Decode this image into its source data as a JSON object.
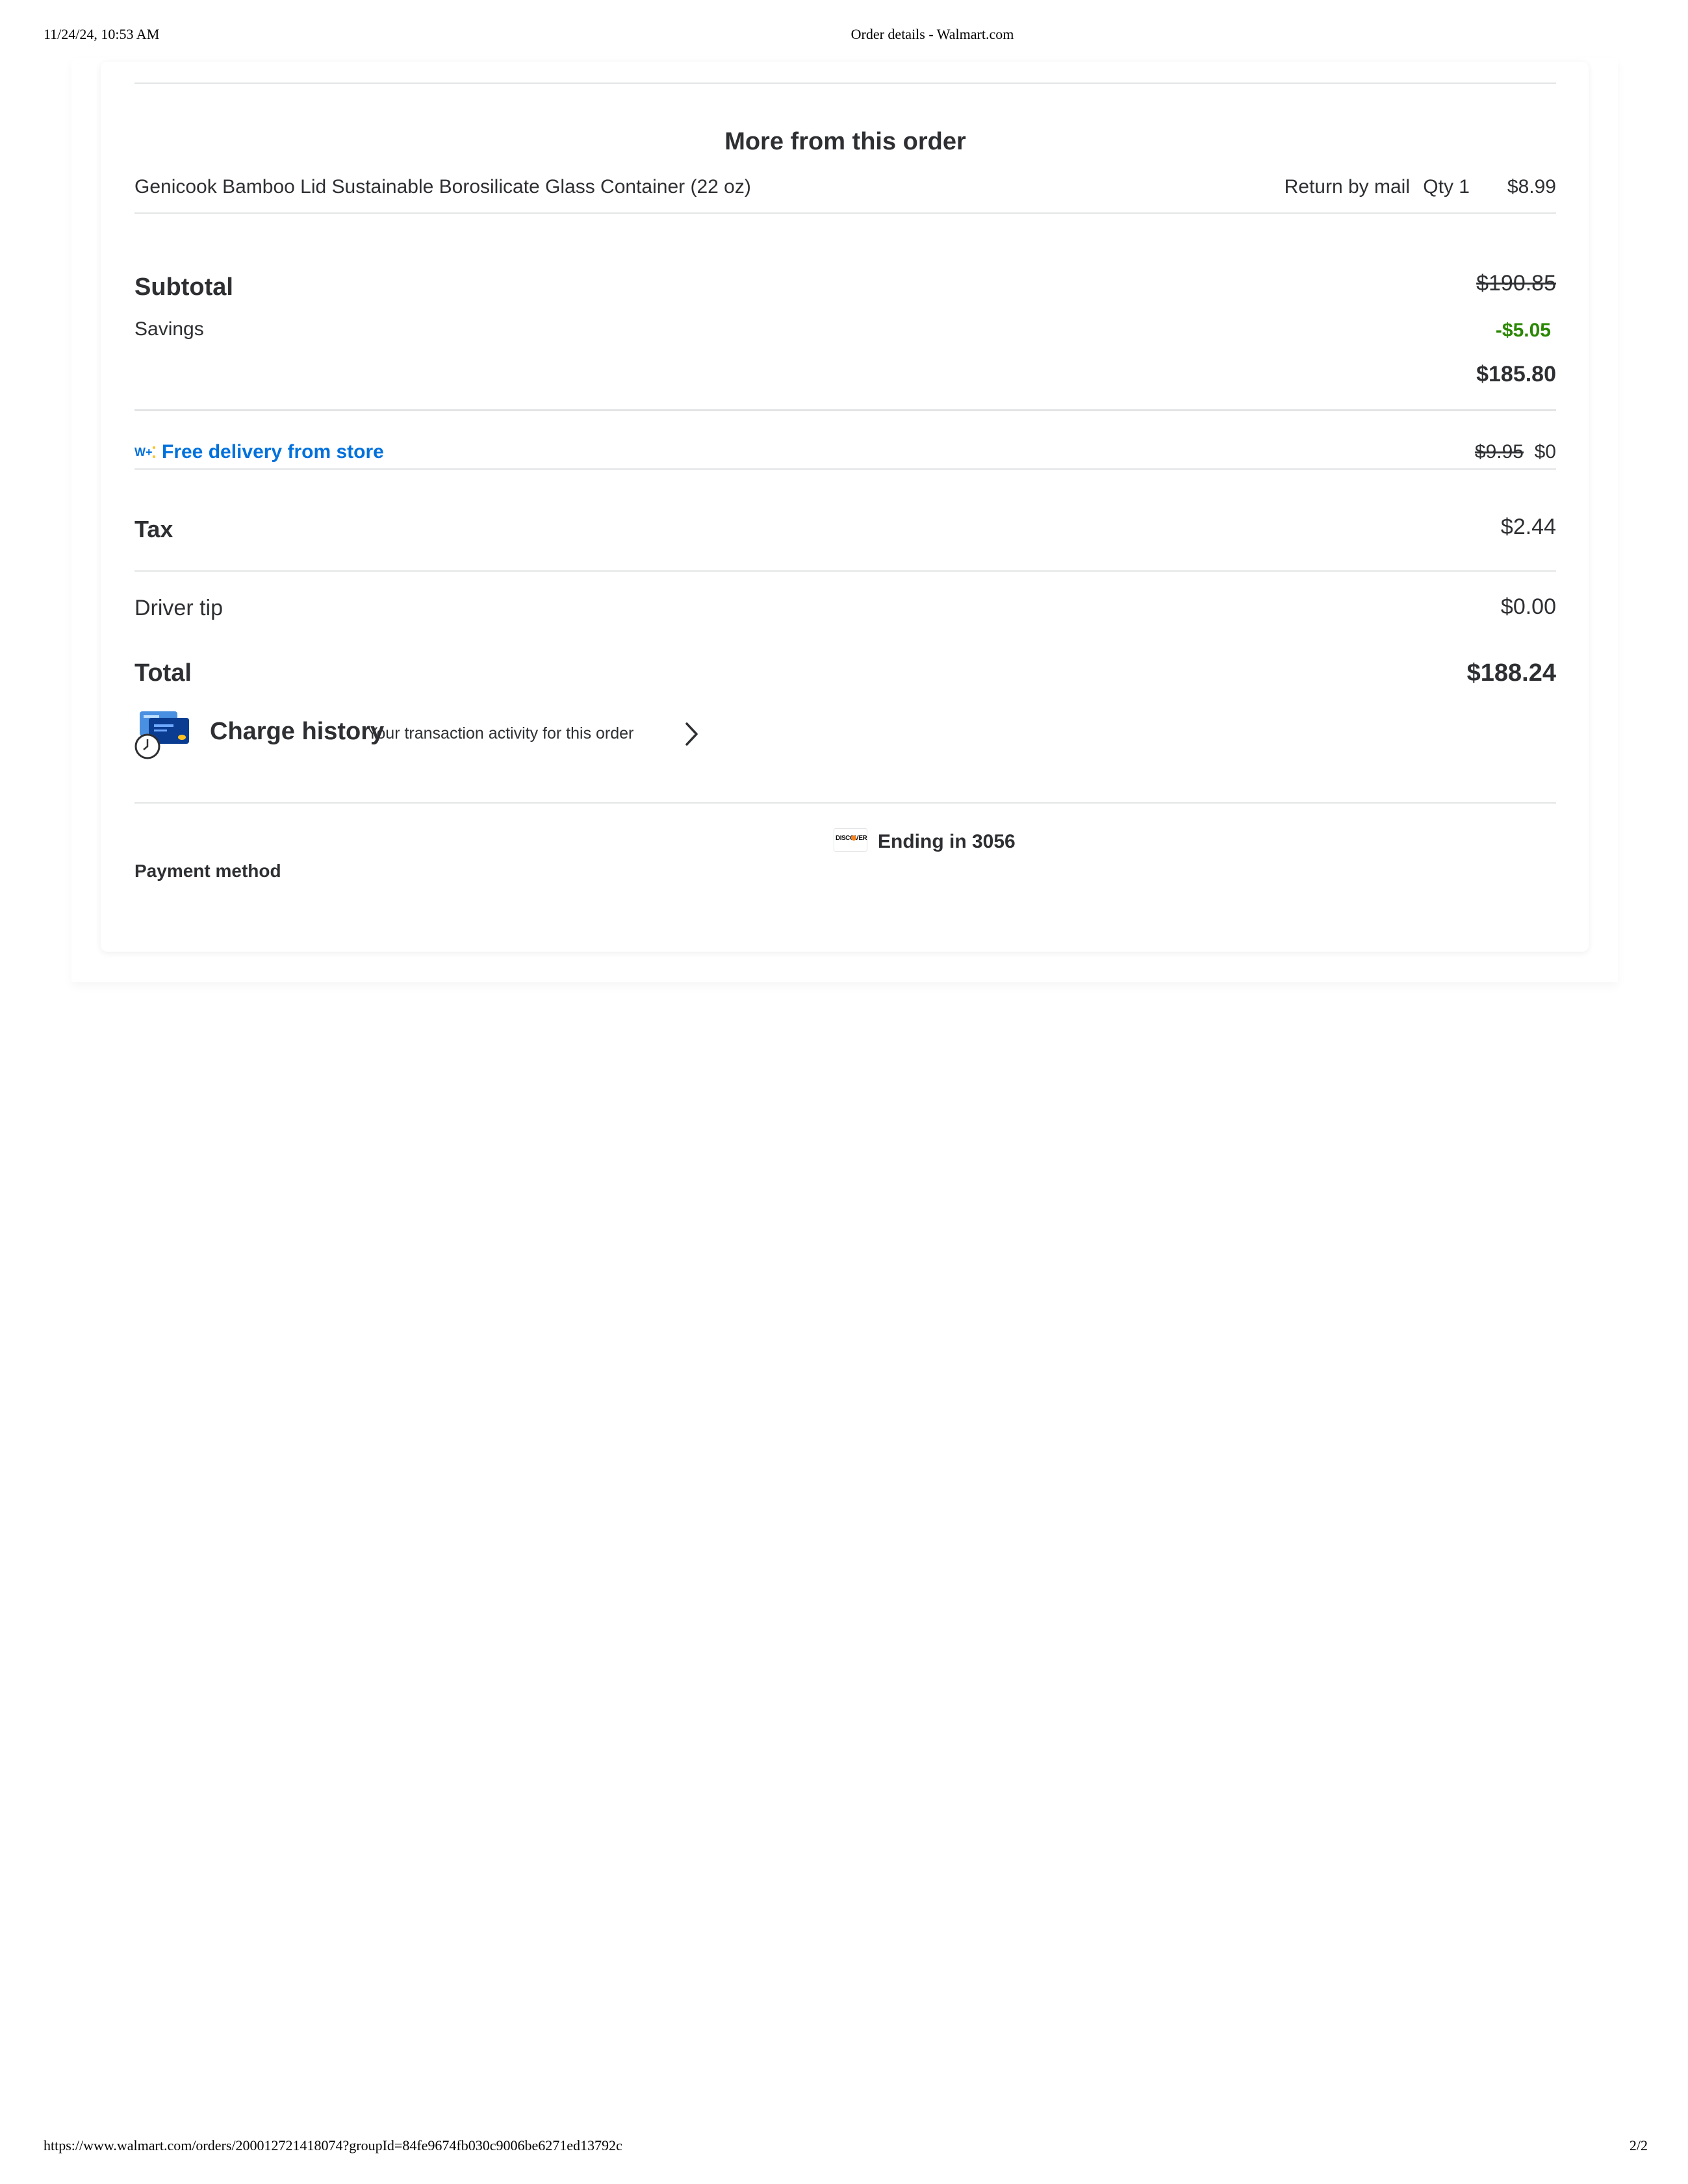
{
  "print_header": {
    "datetime": "11/24/24, 10:53 AM",
    "page_title": "Order details - Walmart.com"
  },
  "print_footer": {
    "url": "https://www.walmart.com/orders/200012721418074?groupId=84fe9674fb030c9006be6271ed13792c",
    "page_number": "2/2"
  },
  "more_from_order": {
    "title": "More from this order",
    "item": {
      "name": "Genicook Bamboo Lid Sustainable Borosilicate Glass Container (22 oz)",
      "return_option": "Return by mail",
      "qty": "Qty 1",
      "price": "$8.99"
    }
  },
  "summary": {
    "subtotal_label": "Subtotal",
    "subtotal_original": "$190.85",
    "savings_label": "Savings",
    "savings_value": "-$5.05",
    "subtotal_final": "$185.80",
    "delivery_label": "Free delivery from store",
    "delivery_original": "$9.95",
    "delivery_value": "$0",
    "tax_label": "Tax",
    "tax_value": "$2.44",
    "tip_label": "Driver tip",
    "tip_value": "$0.00",
    "total_label": "Total",
    "total_value": "$188.24"
  },
  "charge_history": {
    "title": "Charge history",
    "subtitle": "Your transaction activity for this order",
    "icon": "credit-cards-clock-icon",
    "chevron": "chevron-right-icon"
  },
  "payment": {
    "label": "Payment method",
    "card_brand": "DISCOVER",
    "card_text": "Ending in 3056"
  },
  "colors": {
    "savings_green": "#2a8703",
    "link_blue": "#0071dc",
    "text": "#2e2f32",
    "divider": "#e3e4e5"
  }
}
